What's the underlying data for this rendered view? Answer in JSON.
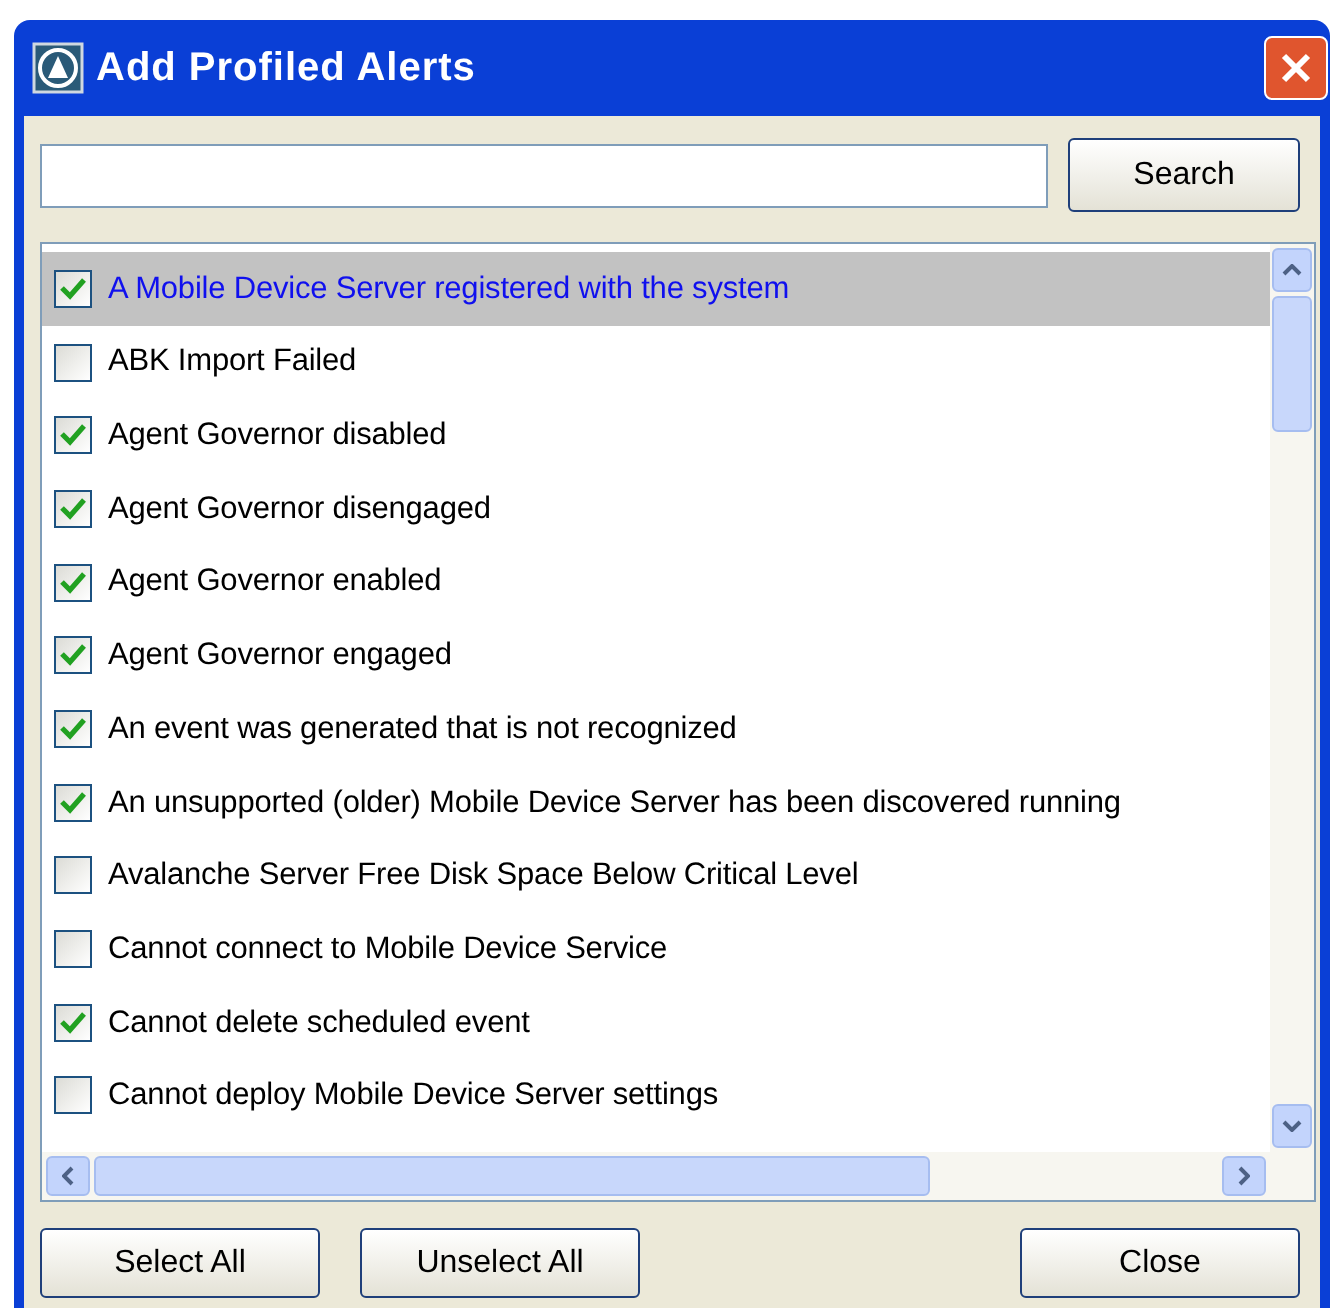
{
  "window": {
    "title": "Add Profiled Alerts"
  },
  "search": {
    "button": "Search"
  },
  "alerts": [
    {
      "label": "A Mobile Device Server registered with the system",
      "checked": true,
      "selected": true
    },
    {
      "label": "ABK Import Failed",
      "checked": false,
      "selected": false
    },
    {
      "label": "Agent Governor disabled",
      "checked": true,
      "selected": false
    },
    {
      "label": "Agent Governor disengaged",
      "checked": true,
      "selected": false
    },
    {
      "label": "Agent Governor enabled",
      "checked": true,
      "selected": false
    },
    {
      "label": "Agent Governor engaged",
      "checked": true,
      "selected": false
    },
    {
      "label": "An event was generated that is not recognized",
      "checked": true,
      "selected": false
    },
    {
      "label": "An unsupported (older) Mobile Device Server has been discovered running",
      "checked": true,
      "selected": false
    },
    {
      "label": "Avalanche Server Free Disk Space Below Critical Level",
      "checked": false,
      "selected": false
    },
    {
      "label": "Cannot connect to Mobile Device Service",
      "checked": false,
      "selected": false
    },
    {
      "label": "Cannot delete scheduled event",
      "checked": true,
      "selected": false
    },
    {
      "label": "Cannot deploy Mobile Device Server settings",
      "checked": false,
      "selected": false
    }
  ],
  "buttons": [
    "Select All",
    "Unselect All",
    "Close"
  ]
}
